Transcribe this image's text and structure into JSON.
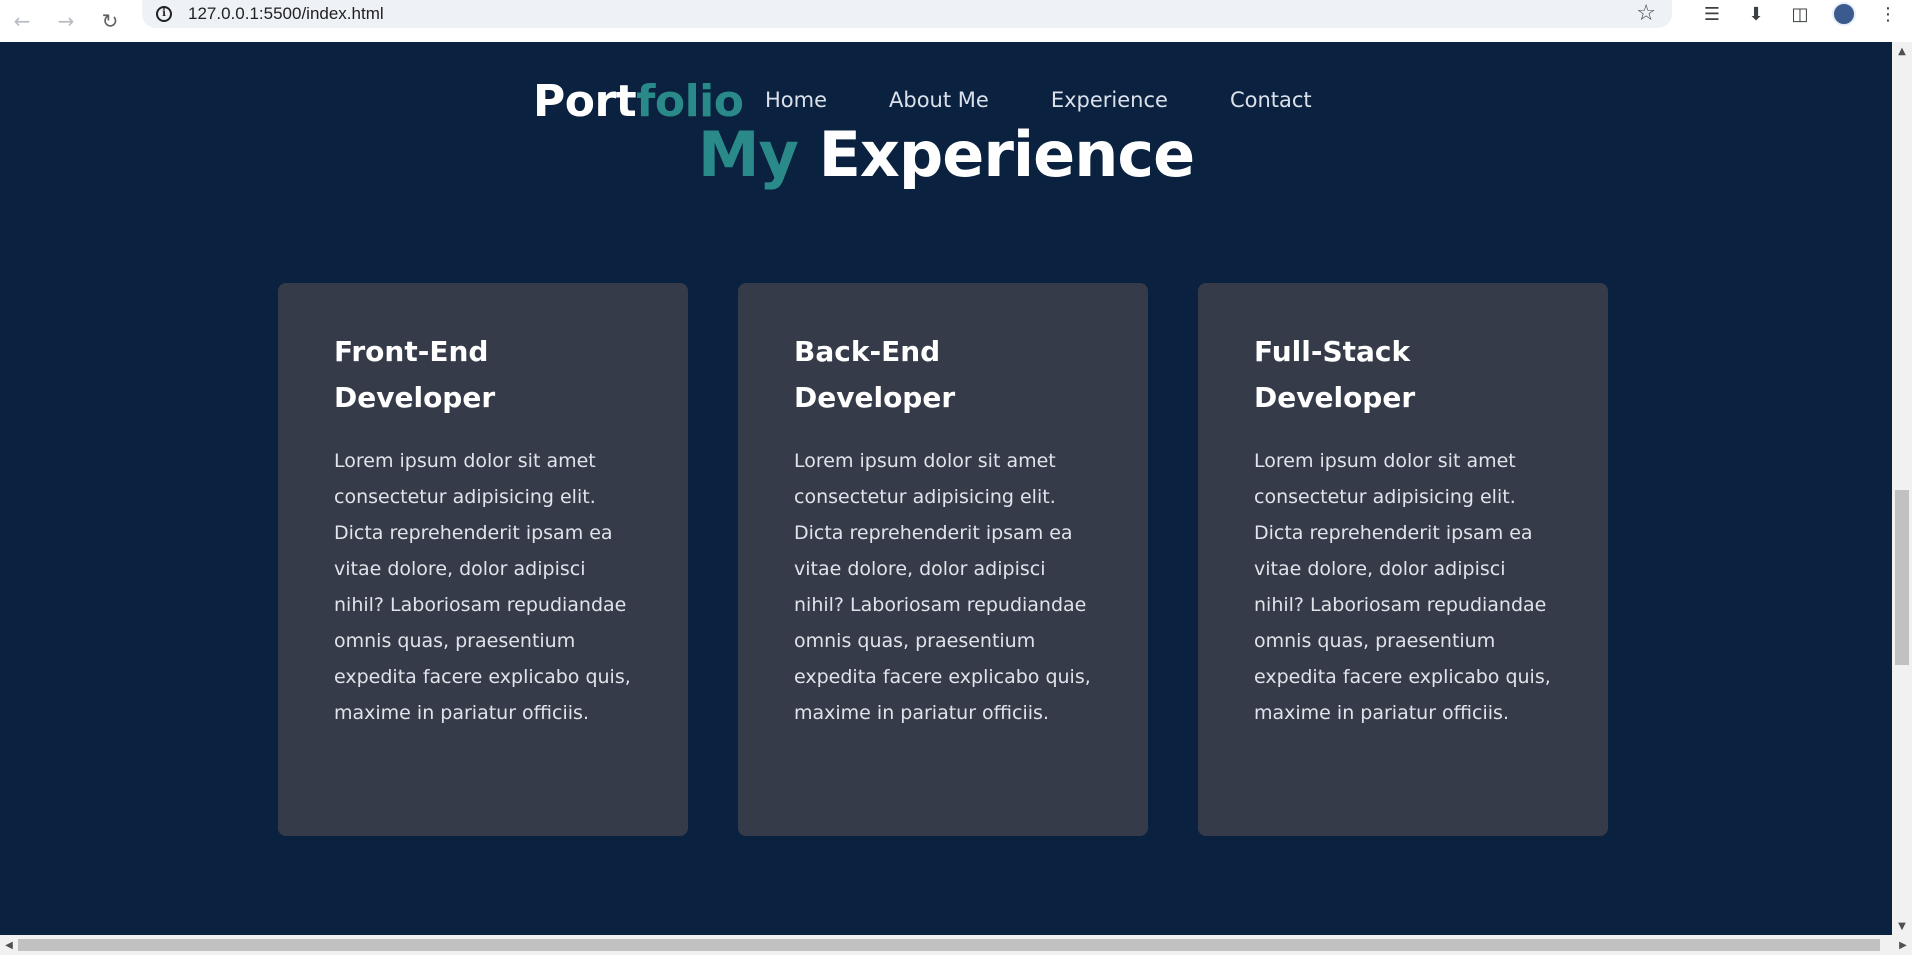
{
  "browser": {
    "url": "127.0.0.1:5500/index.html",
    "icons": [
      "back-arrow-icon",
      "forward-arrow-icon",
      "reload-icon",
      "site-info-icon",
      "bookmark-star-icon",
      "media-control-icon",
      "download-icon",
      "side-panel-icon",
      "profile-avatar-icon",
      "more-menu-icon"
    ]
  },
  "nav": {
    "logo_main": "Port",
    "logo_accent": "folio",
    "links": [
      "Home",
      "About Me",
      "Experience",
      "Contact"
    ]
  },
  "section": {
    "title_accent": "My",
    "title_main": "Experience"
  },
  "cards": [
    {
      "title": "Front-End Developer",
      "body": "Lorem ipsum dolor sit amet consectetur adipisicing elit. Dicta reprehenderit ipsam ea vitae dolore, dolor adipisci nihil? Laboriosam repudiandae omnis quas, praesentium expedita facere explicabo quis, maxime in pariatur officiis."
    },
    {
      "title": "Back-End Developer",
      "body": "Lorem ipsum dolor sit amet consectetur adipisicing elit. Dicta reprehenderit ipsam ea vitae dolore, dolor adipisci nihil? Laboriosam repudiandae omnis quas, praesentium expedita facere explicabo quis, maxime in pariatur officiis."
    },
    {
      "title": "Full-Stack Developer",
      "body": "Lorem ipsum dolor sit amet consectetur adipisicing elit. Dicta reprehenderit ipsam ea vitae dolore, dolor adipisci nihil? Laboriosam repudiandae omnis quas, praesentium expedita facere explicabo quis, maxime in pariatur officiis."
    }
  ],
  "colors": {
    "page_bg": "#0a2140",
    "card_bg": "#363b49",
    "accent": "#2a8a8a",
    "text": "#ffffff"
  }
}
